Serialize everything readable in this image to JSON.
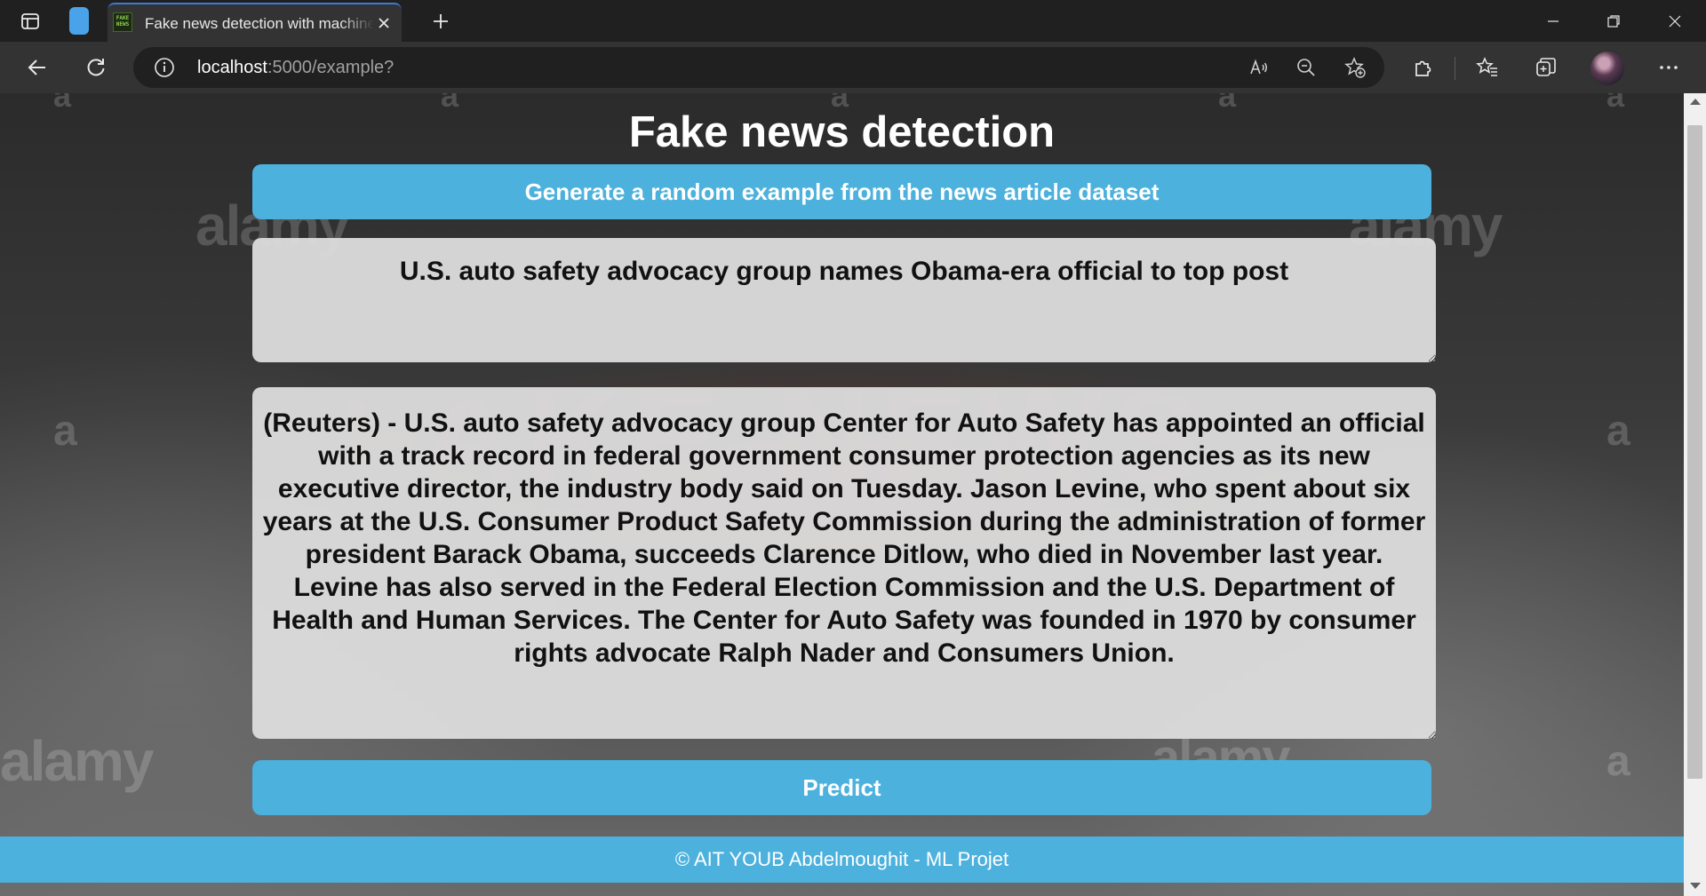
{
  "browser": {
    "tab_title": "Fake news detection with machine learning",
    "favicon_text": "FAKE NEWS",
    "url_host": "localhost",
    "url_rest": ":5000/example?",
    "accent": "#3a7bd5"
  },
  "background": {
    "watermarks": [
      "alamy",
      "alamy",
      "alamy",
      "alamy",
      "a",
      "a",
      "a",
      "a",
      "a",
      "a",
      "a",
      "a"
    ],
    "big_text": "FAKE NEWS"
  },
  "page": {
    "title": "Fake news detection",
    "generate_button": "Generate a random example from the news article dataset",
    "news_title": "U.S. auto safety advocacy group names Obama-era official to top post",
    "news_text": "(Reuters) - U.S. auto safety advocacy group Center for Auto Safety has appointed an official with a track record in federal government consumer protection agencies as its new executive director, the industry body said on Tuesday. Jason Levine, who spent about six years at the U.S. Consumer Product Safety Commission during the administration of former president Barack Obama, succeeds Clarence Ditlow, who died in November last year.  Levine has also served in the Federal Election Commission and the U.S. Department of Health and Human Services. The Center for Auto Safety was founded in 1970 by consumer rights advocate Ralph Nader and Consumers Union.",
    "predict_button": "Predict",
    "footer": "© AIT YOUB Abdelmoughit - ML Projet",
    "button_color": "#4db1dd"
  }
}
